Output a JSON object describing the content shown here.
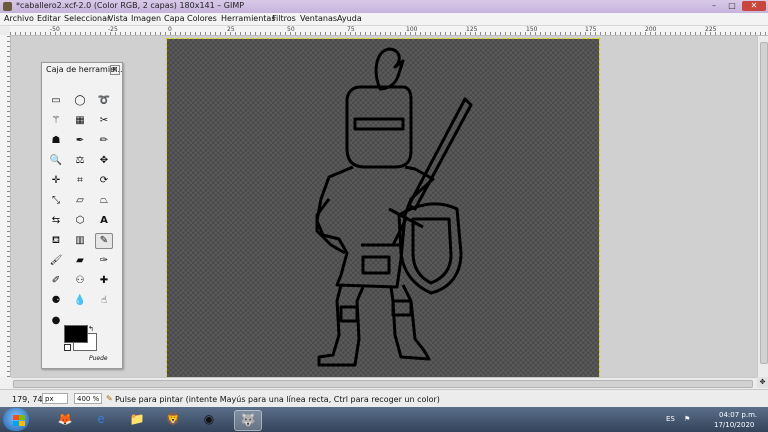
{
  "window": {
    "title": "*caballero2.xcf-2.0 (Color RGB, 2 capas) 180x141 – GIMP",
    "min": "–",
    "max": "□",
    "close": "✕"
  },
  "menu": [
    "Archivo",
    "Editar",
    "Seleccionar",
    "Vista",
    "Imagen",
    "Capa",
    "Colores",
    "Herramientas",
    "Filtros",
    "Ventanas",
    "Ayuda"
  ],
  "ruler": {
    "ticks": [
      "-50",
      "-25",
      "0",
      "25",
      "50",
      "75",
      "100",
      "125",
      "150",
      "175",
      "200",
      "225"
    ]
  },
  "toolbox": {
    "title": "Caja de herramie...",
    "close": "⊠",
    "hint": "Puede",
    "fg_color": "#000000",
    "bg_color": "#ffffff",
    "tools": [
      "rect-select",
      "ellipse-select",
      "free-select",
      "fuzzy-select",
      "color-select",
      "scissors",
      "foreground-select",
      "paths",
      "color-picker",
      "zoom",
      "measure",
      "move",
      "align",
      "crop",
      "rotate",
      "scale",
      "shear",
      "perspective",
      "flip",
      "cage",
      "text",
      "bucket-fill",
      "blend",
      "pencil",
      "paintbrush",
      "eraser",
      "airbrush",
      "ink",
      "clone",
      "heal",
      "perspective-clone",
      "blur",
      "smudge",
      "dodge-burn"
    ],
    "active_tool": "pencil"
  },
  "status": {
    "coords": "179, 74",
    "unit": "px",
    "zoom": "400 %",
    "message": "Pulse para pintar (intente Mayús para una línea recta, Ctrl para recoger un color)"
  },
  "taskbar": {
    "lang": "ES",
    "time": "04:07 p.m.",
    "date": "17/10/2020"
  }
}
